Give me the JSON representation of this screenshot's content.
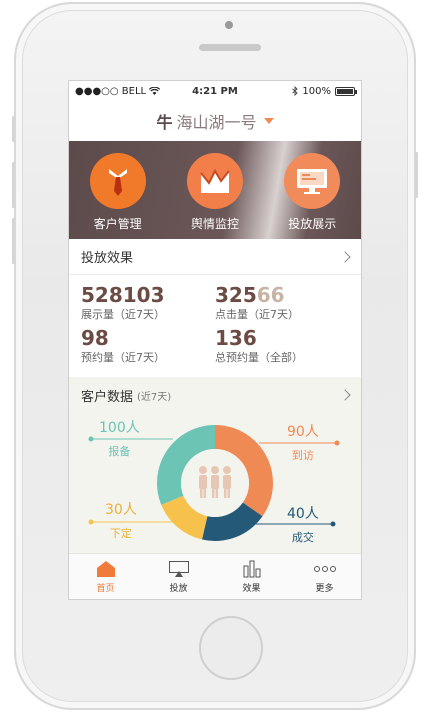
{
  "status_bar": {
    "carrier": "●●●○○ BELL",
    "time": "4:21 PM",
    "battery": "100%"
  },
  "header": {
    "title": "海山湖一号"
  },
  "hero": {
    "items": [
      {
        "label": "客户管理",
        "color": "#f07a2a"
      },
      {
        "label": "舆情监控",
        "color": "#f27f4a"
      },
      {
        "label": "投放展示",
        "color": "#f28b5a"
      }
    ]
  },
  "delivery": {
    "title": "投放效果",
    "stats": [
      {
        "value": "528103",
        "label": "展示量（近7天）"
      },
      {
        "value_main": "325",
        "value_fade": "66",
        "label": "点击量（近7天）"
      },
      {
        "value": "98",
        "label": "预约量（近7天）"
      },
      {
        "value": "136",
        "label": "总预约量（全部）"
      }
    ]
  },
  "customer": {
    "title": "客户数据",
    "subtitle": "(近7天)",
    "segments": [
      {
        "count": "100人",
        "name": "报备",
        "color": "#6bc4b4"
      },
      {
        "count": "90人",
        "name": "到访",
        "color": "#f08a54"
      },
      {
        "count": "40人",
        "name": "成交",
        "color": "#245a78"
      },
      {
        "count": "30人",
        "name": "下定",
        "color": "#f6c24c"
      }
    ]
  },
  "tabbar": {
    "tabs": [
      {
        "label": "首页"
      },
      {
        "label": "投放"
      },
      {
        "label": "效果"
      },
      {
        "label": "更多"
      }
    ]
  }
}
